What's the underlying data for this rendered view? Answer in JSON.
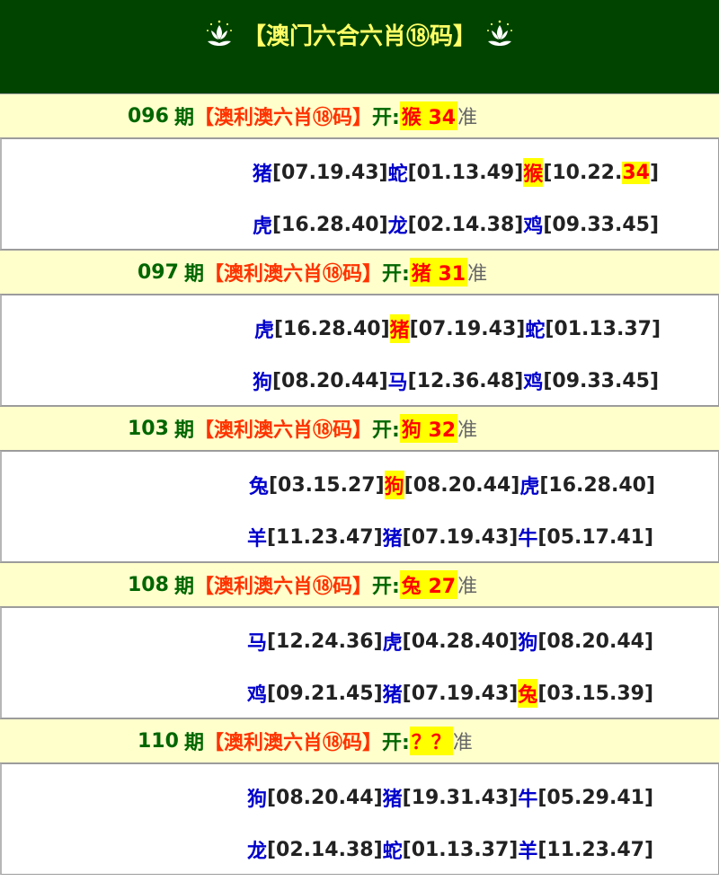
{
  "header": {
    "title": "【澳门六合六肖⑱码】"
  },
  "label_unit": "期",
  "label_name": "【澳利澳六肖⑱码】",
  "label_kai": "开:",
  "label_zhun": "准",
  "colors": {
    "header_bg": "#004400",
    "title": "#ffff66",
    "row_bg": "#ffffcc",
    "zodiac": "#0000cc",
    "highlight": "#ffff00",
    "hit_text": "#ff0000"
  },
  "periods": [
    {
      "no": "096",
      "result": "猴 34",
      "lines": [
        {
          "a": "猪",
          "an": "[07.19.43]",
          "b": "蛇",
          "bn": "[01.13.49]",
          "c": "猴",
          "cn_pre": "[10.22.",
          "cn_hit": "34",
          "cn_post": "]"
        },
        {
          "a": "虎",
          "an": "[16.28.40]",
          "b": "龙",
          "bn": "[02.14.38]",
          "c": "鸡",
          "cn": "[09.33.45]"
        }
      ]
    },
    {
      "no": "097",
      "result": "猪 31",
      "lines": [
        {
          "a": "虎",
          "an": "[16.28.40]",
          "b": "猪",
          "bn": "[07.19.43]",
          "c": "蛇",
          "cn": "[01.13.37]"
        },
        {
          "a": "狗",
          "an": "[08.20.44]",
          "b": "马",
          "bn": "[12.36.48]",
          "c": "鸡",
          "cn": "[09.33.45]"
        }
      ]
    },
    {
      "no": "103",
      "result": "狗 32",
      "lines": [
        {
          "a": "兔",
          "an": "[03.15.27]",
          "b": "狗",
          "bn": "[08.20.44]",
          "c": "虎",
          "cn": "[16.28.40]"
        },
        {
          "a": "羊",
          "an": "[11.23.47]",
          "b": "猪",
          "bn": "[07.19.43]",
          "c": "牛",
          "cn": "[05.17.41]"
        }
      ]
    },
    {
      "no": "108",
      "result": "兔 27",
      "lines": [
        {
          "a": "马",
          "an": "[12.24.36]",
          "b": "虎",
          "bn": "[04.28.40]",
          "c": "狗",
          "cn": "[08.20.44]"
        },
        {
          "a": "鸡",
          "an": "[09.21.45]",
          "b": "猪",
          "bn": "[07.19.43]",
          "c": "兔",
          "cn": "[03.15.39]"
        }
      ]
    },
    {
      "no": "110",
      "result": "？？",
      "lines": [
        {
          "a": "狗",
          "an": "[08.20.44]",
          "b": "猪",
          "bn": "[19.31.43]",
          "c": "牛",
          "cn": "[05.29.41]"
        },
        {
          "a": "龙",
          "an": "[02.14.38]",
          "b": "蛇",
          "bn": "[01.13.37]",
          "c": "羊",
          "cn": "[11.23.47]"
        }
      ]
    }
  ]
}
